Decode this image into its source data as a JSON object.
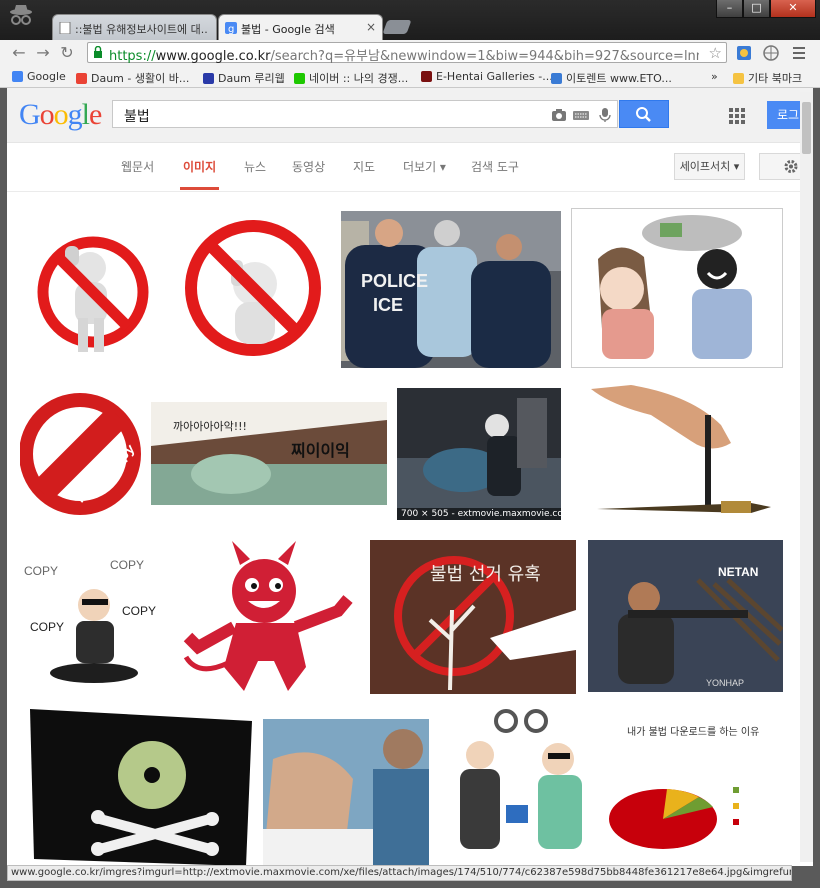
{
  "tabs": [
    {
      "label": "::불법 유해정보사이트에 대..",
      "active": false
    },
    {
      "label": "불법 - Google 검색",
      "active": true
    }
  ],
  "omnibox": {
    "scheme": "https://",
    "host": "www.google.co.kr",
    "path": "/search?q=유부남&newwindow=1&biw=944&bih=927&source=lnms&tbm"
  },
  "bookmarks": [
    {
      "label": "Google",
      "color": "#4285f4"
    },
    {
      "label": "Daum - 생활이 바...",
      "color": "#ea4335"
    },
    {
      "label": "Daum 루리웹",
      "color": "#2a3aa8"
    },
    {
      "label": "네이버 :: 나의 경쟁...",
      "color": "#1ec800"
    },
    {
      "label": "E-Hentai Galleries -...",
      "color": "#7a1010"
    },
    {
      "label": "이토렌트 www.ETO...",
      "color": "#3a7bd5"
    },
    {
      "label": "»",
      "color": ""
    },
    {
      "label": "기타 북마크",
      "color": "#f5c342"
    }
  ],
  "google": {
    "logo": [
      "G",
      "o",
      "o",
      "g",
      "l",
      "e"
    ],
    "logo_colors": [
      "#4285f4",
      "#ea4335",
      "#fbbc05",
      "#4285f4",
      "#34a853",
      "#ea4335"
    ],
    "query": "불법",
    "login": "로그"
  },
  "nav": {
    "items": [
      "웹문서",
      "이미지",
      "뉴스",
      "동영상",
      "지도",
      "더보기 ▾",
      "검색 도구"
    ],
    "active_index": 1,
    "safesearch": "세이프서치 ▾"
  },
  "results": {
    "overlay": "700 × 505 - extmovie.maxmovie.com",
    "labels": {
      "police": "POLICE",
      "ice": "ICE",
      "illegal": "illegal copy",
      "comic_shout": "까아아아아악!!!",
      "comic_big": "찌이이익",
      "copy": "COPY",
      "netan": "NETAN",
      "yonhap": "YONHAP",
      "chart_title": "내가 불법 다운로드를 하는 이유",
      "tree": "불법 선거 유혹"
    }
  },
  "status_url": "www.google.co.kr/imgres?imgurl=http://extmovie.maxmovie.com/xe/files/attach/images/174/510/774/c62387e598d75bb8448fe361217e8e64.jpg&imgrefurl=http://ext..."
}
